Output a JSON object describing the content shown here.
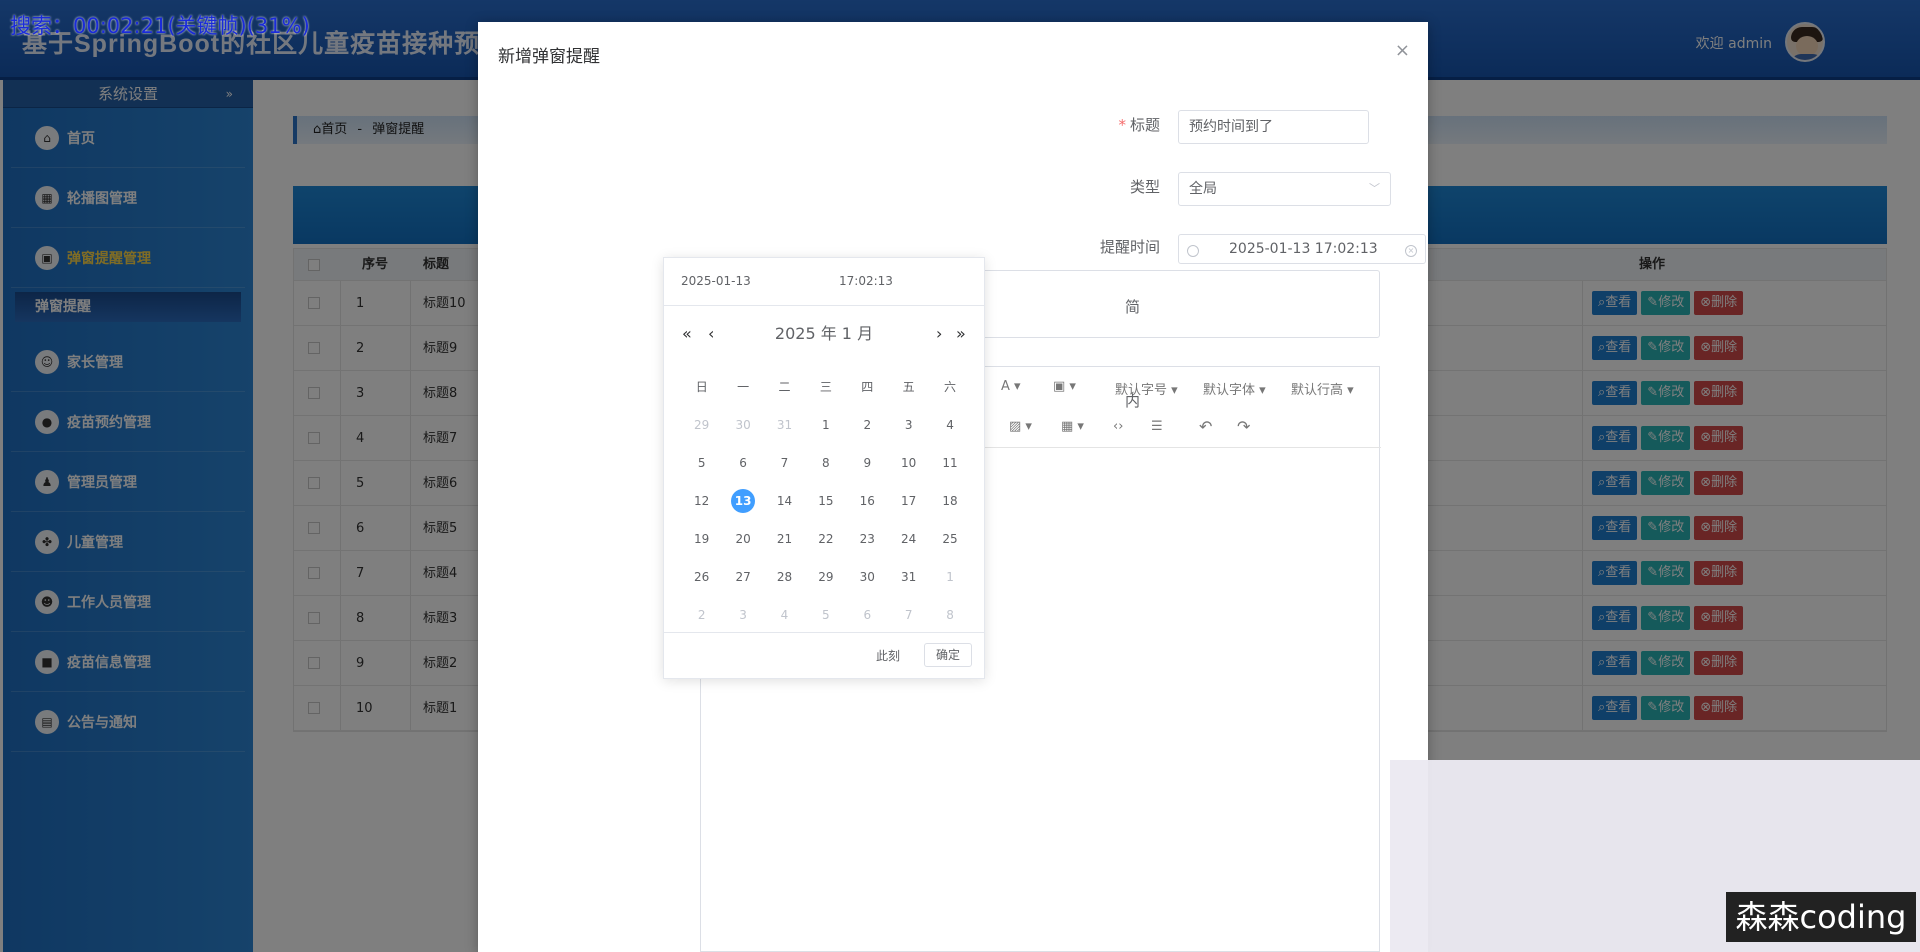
{
  "recording_overlay": "搜索：00:02:21(关键帧)(31%)",
  "app": {
    "title": "基于SpringBoot的社区儿童疫苗接种预约系统",
    "welcome": "欢迎 admin"
  },
  "sidebar": {
    "section_title": "系统设置",
    "items": [
      {
        "label": "首页"
      },
      {
        "label": "轮播图管理"
      },
      {
        "label": "弹窗提醒管理"
      },
      {
        "label": "家长管理"
      },
      {
        "label": "疫苗预约管理"
      },
      {
        "label": "管理员管理"
      },
      {
        "label": "儿童管理"
      },
      {
        "label": "工作人员管理"
      },
      {
        "label": "疫苗信息管理"
      },
      {
        "label": "公告与通知"
      }
    ],
    "sub_active": "弹窗提醒"
  },
  "breadcrumb": {
    "home": "首页",
    "sep": "-",
    "current": "弹窗提醒"
  },
  "table": {
    "headers": {
      "index": "序号",
      "title": "标题",
      "ops": "操作"
    },
    "rows": [
      {
        "index": "1",
        "title": "标题10"
      },
      {
        "index": "2",
        "title": "标题9"
      },
      {
        "index": "3",
        "title": "标题8"
      },
      {
        "index": "4",
        "title": "标题7"
      },
      {
        "index": "5",
        "title": "标题6"
      },
      {
        "index": "6",
        "title": "标题5"
      },
      {
        "index": "7",
        "title": "标题4"
      },
      {
        "index": "8",
        "title": "标题3"
      },
      {
        "index": "9",
        "title": "标题2"
      },
      {
        "index": "10",
        "title": "标题1"
      }
    ],
    "op_view": "查看",
    "op_edit": "修改",
    "op_delete": "删除"
  },
  "dialog": {
    "title": "新增弹窗提醒",
    "close": "×",
    "labels": {
      "title": "标题",
      "type": "类型",
      "remind_time": "提醒时间",
      "summary": "简",
      "content": "内"
    },
    "values": {
      "title": "预约时间到了",
      "type": "全局",
      "remind_time": "2025-01-13 17:02:13"
    },
    "editor_toolbar": {
      "font_size": "默认字号",
      "font_family": "默认字体",
      "line_height": "默认行高"
    }
  },
  "date_picker": {
    "date_input": "2025-01-13",
    "time_input": "17:02:13",
    "header": "2025 年  1 月",
    "weekdays": [
      "日",
      "一",
      "二",
      "三",
      "四",
      "五",
      "六"
    ],
    "weeks": [
      [
        "29",
        "30",
        "31",
        "1",
        "2",
        "3",
        "4"
      ],
      [
        "5",
        "6",
        "7",
        "8",
        "9",
        "10",
        "11"
      ],
      [
        "12",
        "13",
        "14",
        "15",
        "16",
        "17",
        "18"
      ],
      [
        "19",
        "20",
        "21",
        "22",
        "23",
        "24",
        "25"
      ],
      [
        "26",
        "27",
        "28",
        "29",
        "30",
        "31",
        "1"
      ],
      [
        "2",
        "3",
        "4",
        "5",
        "6",
        "7",
        "8"
      ]
    ],
    "selected_day": "13",
    "now_label": "此刻",
    "confirm_label": "确定"
  },
  "watermark": "森森coding"
}
